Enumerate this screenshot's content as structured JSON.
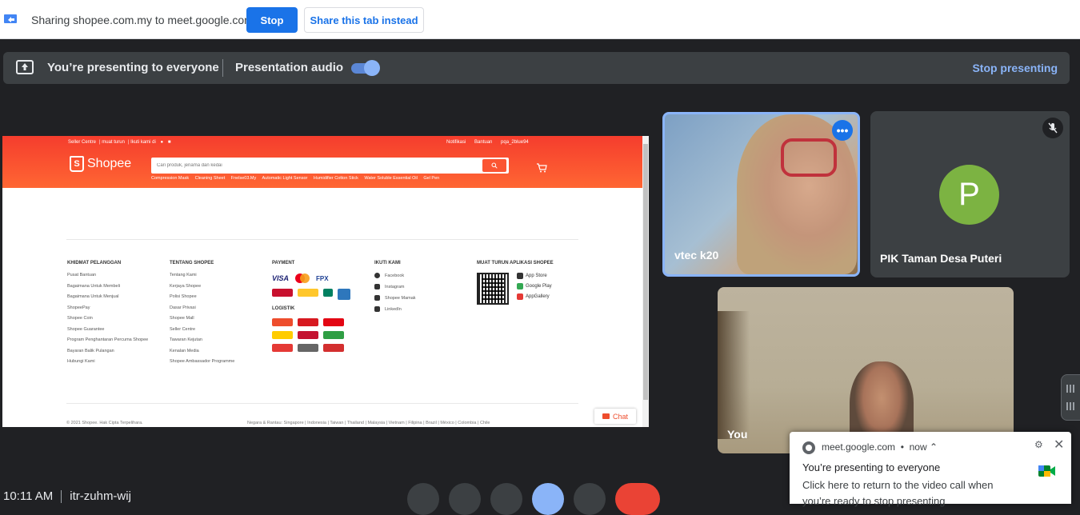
{
  "sharebar": {
    "text": "Sharing shopee.com.my to meet.google.com",
    "stop": "Stop",
    "share_tab": "Share this tab instead"
  },
  "present_bar": {
    "text": "You’re presenting to everyone",
    "audio": "Presentation audio",
    "audio_on": true,
    "stop": "Stop presenting"
  },
  "shopee": {
    "topnav": [
      "Seller Centre",
      "muat turun",
      "Ikuti kami di"
    ],
    "topright": [
      "Notifikasi",
      "Bantuan",
      "pqa_2blue94"
    ],
    "logo_text": "Shopee",
    "search_placeholder": "Cari produk, jenama dan kedai",
    "tags": [
      "Compression Mask",
      "Cleaning Sheet",
      "Fnelse03.My",
      "Automatic Light Sensor",
      "Humidifier Cotton Stick",
      "Water Soluble Essential Oil",
      "Gel Pen"
    ],
    "col1": {
      "heading": "KHIDMAT PELANGGAN",
      "items": [
        "Pusat Bantuan",
        "Bagaimana Untuk Membeli",
        "Bagaimana Untuk Menjual",
        "ShopeePay",
        "Shopee Coin",
        "Shopee Guarantee",
        "Program Penghantaran Percuma Shopee",
        "Bayaran Balik Pulangan",
        "Hubungi Kami"
      ]
    },
    "col2": {
      "heading": "TENTANG SHOPEE",
      "items": [
        "Tentang Kami",
        "Kerjaya Shopee",
        "Polisi Shopee",
        "Dasar Privasi",
        "Shopee Mall",
        "Seller Centre",
        "Tawaran Kejutan",
        "Kenalan Media",
        "Shopee Ambassador Programme"
      ]
    },
    "payment_heading": "PAYMENT",
    "payment_logos": [
      "VISA",
      "FPX"
    ],
    "logistic_heading": "LOGISTIK",
    "follow": {
      "heading": "IKUTI KAMI",
      "items": [
        "Facebook",
        "Instagram",
        "Shopee Mamak",
        "LinkedIn"
      ]
    },
    "app": {
      "heading": "MUAT TURUN APLIKASI SHOPEE",
      "stores": [
        "App Store",
        "Google Play",
        "AppGallery"
      ]
    },
    "copyright": "© 2021 Shopee. Hak Cipta Terpelihara.",
    "countries": "Negara & Rantau: Singapore | Indonesia | Taiwan | Thailand | Malaysia | Vietnam | Filipina | Brazil | México | Colombia | Chile",
    "chat": "Chat"
  },
  "participants": {
    "vtec": "vtec k20",
    "pik": "PIK Taman Desa Puteri",
    "pik_initial": "P",
    "you": "You"
  },
  "notification": {
    "source": "meet.google.com",
    "time": "now",
    "title": "You’re presenting to everyone",
    "body": "Click here to return to the video call when you’re ready to stop presenting"
  },
  "bottom": {
    "time": "10:11 AM",
    "meeting_code": "itr-zuhm-wij"
  },
  "colors": {
    "accent": "#1a73e8",
    "light_accent": "#8ab4f8",
    "shopee_orange": "#f53d2d",
    "hangup": "#ea4335"
  }
}
